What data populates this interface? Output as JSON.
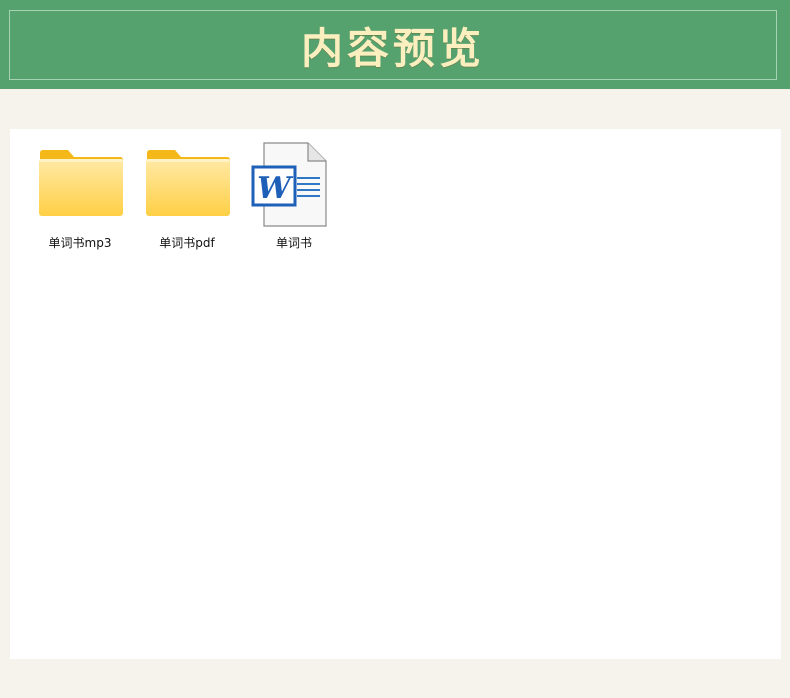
{
  "header": {
    "title": "内容预览"
  },
  "files": [
    {
      "name": "单词书mp3",
      "type": "folder",
      "icon": "folder-icon"
    },
    {
      "name": "单词书pdf",
      "type": "folder",
      "icon": "folder-icon"
    },
    {
      "name": "单词书",
      "type": "word-document",
      "icon": "word-document-icon"
    }
  ],
  "colors": {
    "banner": "#56a26f",
    "title": "#fbefc0",
    "page_background": "#f6f3ec",
    "folder": "#ffd45e",
    "word_blue": "#1e5fb8"
  }
}
